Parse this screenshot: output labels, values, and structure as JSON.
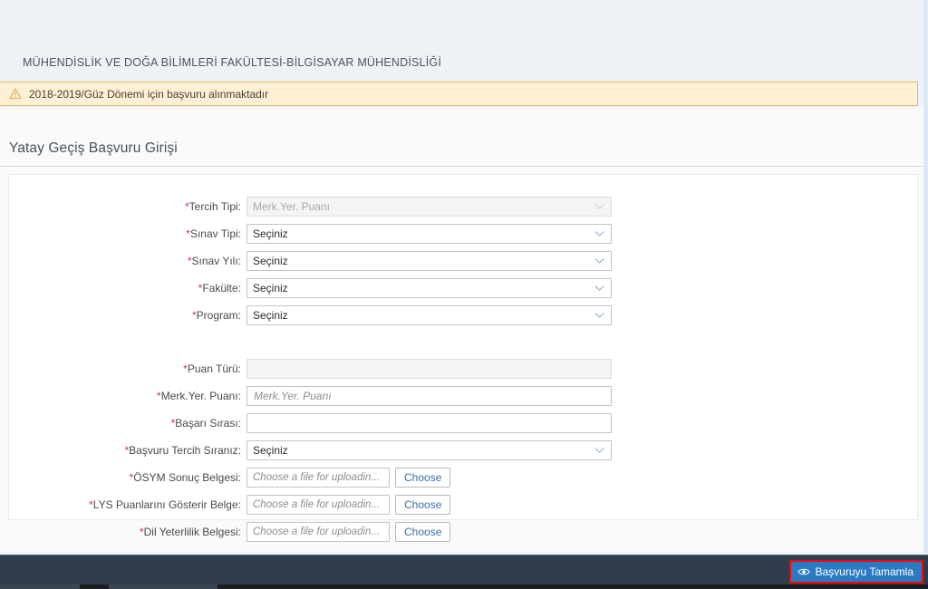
{
  "header": {
    "faculty_title": "MÜHENDİSLİK VE DOĞA BİLİMLERİ FAKÜLTESİ-BİLGİSAYAR MÜHENDİSLİĞİ"
  },
  "warning": {
    "icon": "warning-triangle-icon",
    "message": "2018-2019/Güz Dönemi için başvuru alınmaktadır",
    "border_color": "#e8b964",
    "background_color": "#fdf0d5"
  },
  "page": {
    "title": "Yatay Geçiş Başvuru Girişi"
  },
  "form": {
    "required_marker": "*",
    "select_placeholder": "Seçiniz",
    "groups": [
      {
        "rows": [
          {
            "id": "tercih-tipi",
            "label": "Tercih Tipi:",
            "type": "select",
            "value": "Merk.Yer. Puanı",
            "disabled": true,
            "required": true
          },
          {
            "id": "sinav-tipi",
            "label": "Sınav Tipi:",
            "type": "select",
            "value": "Seçiniz",
            "disabled": false,
            "required": true
          },
          {
            "id": "sinav-yili",
            "label": "Sınav Yılı:",
            "type": "select",
            "value": "Seçiniz",
            "disabled": false,
            "required": true
          },
          {
            "id": "fakulte",
            "label": "Fakülte:",
            "type": "select",
            "value": "Seçiniz",
            "disabled": false,
            "required": true
          },
          {
            "id": "program",
            "label": "Program:",
            "type": "select",
            "value": "Seçiniz",
            "disabled": false,
            "required": true
          }
        ]
      },
      {
        "rows": [
          {
            "id": "puan-turu",
            "label": "Puan Türü:",
            "type": "text",
            "value": "",
            "placeholder": "",
            "disabled": true,
            "required": true
          },
          {
            "id": "merk-yer-puani",
            "label": "Merk.Yer. Puanı:",
            "type": "text",
            "value": "",
            "placeholder": "Merk.Yer. Puanı",
            "disabled": false,
            "required": true
          },
          {
            "id": "basari-sirasi",
            "label": "Başarı Sırası:",
            "type": "text",
            "value": "",
            "placeholder": "",
            "disabled": false,
            "required": true
          },
          {
            "id": "basvuru-tercih-siraniz",
            "label": "Başvuru Tercih Sıranız:",
            "type": "select",
            "value": "Seçiniz",
            "disabled": false,
            "required": true
          },
          {
            "id": "osym-sonuc-belgesi",
            "label": "ÖSYM Sonuç Belgesi:",
            "type": "file",
            "value": "Choose a file for uploadin...",
            "button": "Choose",
            "required": true
          },
          {
            "id": "lys-puanlarini-gosterir-belge",
            "label": "LYS Puanlarını Gösterir Belge:",
            "type": "file",
            "value": "Choose a file for uploadin...",
            "button": "Choose",
            "required": true
          },
          {
            "id": "dil-yeterlilik-belgesi",
            "label": "Dil Yeterlilik Belgesi:",
            "type": "file",
            "value": "Choose a file for uploadin...",
            "button": "Choose",
            "required": true
          }
        ]
      }
    ]
  },
  "footer": {
    "submit_label": "Başvuruyu Tamamla",
    "submit_icon": "eye-icon",
    "submit_color": "#2b7bc4",
    "highlight_color": "#ff0000"
  }
}
